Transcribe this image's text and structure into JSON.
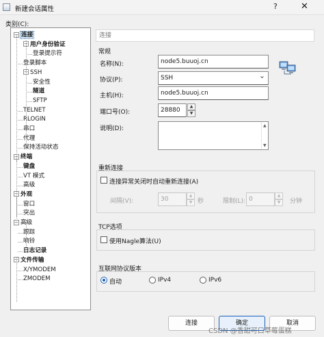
{
  "window": {
    "title": "新建会话属性",
    "help_glyph": "?",
    "close_glyph": "✕"
  },
  "category_label": "类别(C):",
  "tree": [
    {
      "label": "连接",
      "indent": 0,
      "toggle": "−",
      "bold": true,
      "selected": true
    },
    {
      "label": "用户身份验证",
      "indent": 1,
      "toggle": "−",
      "bold": true
    },
    {
      "label": "登录提示符",
      "indent": 2,
      "toggle": "",
      "bold": false
    },
    {
      "label": "登录脚本",
      "indent": 1,
      "toggle": "",
      "bold": false
    },
    {
      "label": "SSH",
      "indent": 1,
      "toggle": "−",
      "bold": false
    },
    {
      "label": "安全性",
      "indent": 2,
      "toggle": "",
      "bold": false
    },
    {
      "label": "隧道",
      "indent": 2,
      "toggle": "",
      "bold": true
    },
    {
      "label": "SFTP",
      "indent": 2,
      "toggle": "",
      "bold": false
    },
    {
      "label": "TELNET",
      "indent": 1,
      "toggle": "",
      "bold": false
    },
    {
      "label": "RLOGIN",
      "indent": 1,
      "toggle": "",
      "bold": false
    },
    {
      "label": "串口",
      "indent": 1,
      "toggle": "",
      "bold": false
    },
    {
      "label": "代理",
      "indent": 1,
      "toggle": "",
      "bold": false
    },
    {
      "label": "保持活动状态",
      "indent": 1,
      "toggle": "",
      "bold": false
    },
    {
      "label": "终端",
      "indent": 0,
      "toggle": "−",
      "bold": true
    },
    {
      "label": "键盘",
      "indent": 1,
      "toggle": "",
      "bold": true
    },
    {
      "label": "VT 模式",
      "indent": 1,
      "toggle": "",
      "bold": false
    },
    {
      "label": "高级",
      "indent": 1,
      "toggle": "",
      "bold": false
    },
    {
      "label": "外观",
      "indent": 0,
      "toggle": "−",
      "bold": true
    },
    {
      "label": "窗口",
      "indent": 1,
      "toggle": "",
      "bold": false
    },
    {
      "label": "突出",
      "indent": 1,
      "toggle": "",
      "bold": false
    },
    {
      "label": "高级",
      "indent": 0,
      "toggle": "−",
      "bold": false
    },
    {
      "label": "跟踪",
      "indent": 1,
      "toggle": "",
      "bold": false
    },
    {
      "label": "响铃",
      "indent": 1,
      "toggle": "",
      "bold": false
    },
    {
      "label": "日志记录",
      "indent": 1,
      "toggle": "",
      "bold": true
    },
    {
      "label": "文件传输",
      "indent": 0,
      "toggle": "−",
      "bold": true
    },
    {
      "label": "X/YMODEM",
      "indent": 1,
      "toggle": "",
      "bold": false
    },
    {
      "label": "ZMODEM",
      "indent": 1,
      "toggle": "",
      "bold": false
    }
  ],
  "panel": {
    "header": "连接",
    "general": {
      "title": "常规",
      "name_label": "名称(N):",
      "name_value": "node5.buuoj.cn",
      "protocol_label": "协议(P):",
      "protocol_value": "SSH",
      "host_label": "主机(H):",
      "host_value": "node5.buuoj.cn",
      "port_label": "端口号(O):",
      "port_value": "28880",
      "desc_label": "说明(D):",
      "desc_value": ""
    },
    "reconnect": {
      "title": "重新连接",
      "checkbox_label": "连接异常关闭时自动重新连接(A)",
      "interval_label": "间隔(V):",
      "interval_value": "30",
      "interval_unit": "秒",
      "limit_label": "限制(L):",
      "limit_value": "0",
      "limit_unit": "分钟"
    },
    "tcp": {
      "title": "TCP选项",
      "nagle_label": "使用Nagle算法(U)"
    },
    "ipver": {
      "title": "互联网协议版本",
      "options": [
        "自动",
        "IPv4",
        "IPv6"
      ],
      "selected": "自动"
    }
  },
  "buttons": {
    "connect": "连接",
    "ok": "确定",
    "cancel": "取消"
  },
  "watermark": "CSDN @香甜可口草莓蛋糕",
  "colors": {
    "accent": "#1a5fb4",
    "selection": "#cde3f7"
  }
}
